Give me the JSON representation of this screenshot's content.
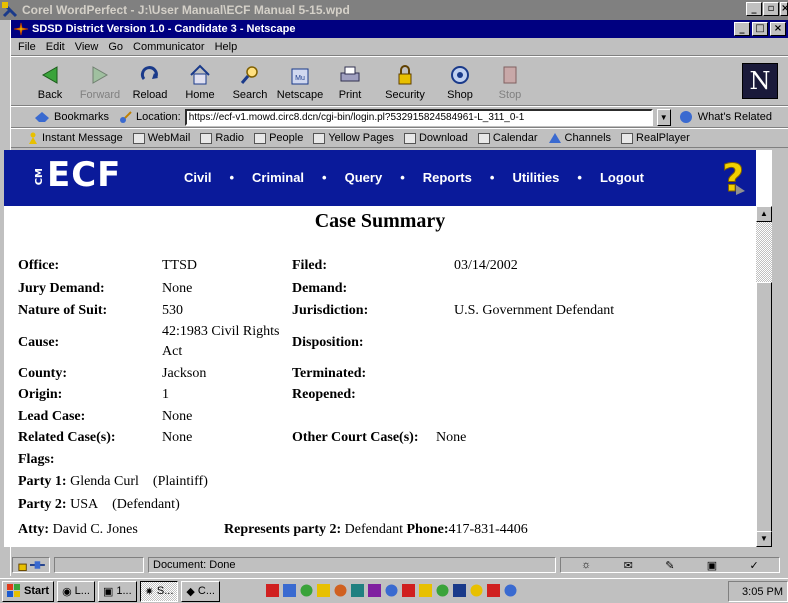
{
  "outer_window": {
    "title": "Corel WordPerfect - J:\\User Manual\\ECF Manual 5-15.wpd"
  },
  "browser": {
    "title": "SDSD District Version 1.0 - Candidate 3 - Netscape",
    "menu": [
      "File",
      "Edit",
      "View",
      "Go",
      "Communicator",
      "Help"
    ],
    "toolbar": [
      {
        "label": "Back",
        "icon": "back-arrow-icon"
      },
      {
        "label": "Forward",
        "icon": "forward-arrow-icon",
        "disabled": true
      },
      {
        "label": "Reload",
        "icon": "reload-icon"
      },
      {
        "label": "Home",
        "icon": "home-icon"
      },
      {
        "label": "Search",
        "icon": "search-icon"
      },
      {
        "label": "Netscape",
        "icon": "netscape-icon"
      },
      {
        "label": "Print",
        "icon": "print-icon"
      },
      {
        "label": "Security",
        "icon": "lock-icon"
      },
      {
        "label": "Shop",
        "icon": "shop-icon"
      },
      {
        "label": "Stop",
        "icon": "stop-icon",
        "disabled": true
      }
    ],
    "bookmarks_label": "Bookmarks",
    "location_label": "Location:",
    "location_url": "https://ecf-v1.mowd.circ8.dcn/cgi-bin/login.pl?532915824584961-L_311_0-1",
    "whats_related": "What's Related",
    "personal": [
      "Instant Message",
      "WebMail",
      "Radio",
      "People",
      "Yellow Pages",
      "Download",
      "Calendar",
      "Channels",
      "RealPlayer"
    ],
    "status_text": "Document: Done"
  },
  "cmecf": {
    "logo_small": "CM",
    "logo_big": "ECF",
    "nav": [
      "Civil",
      "Criminal",
      "Query",
      "Reports",
      "Utilities",
      "Logout"
    ],
    "separator": "•"
  },
  "page": {
    "title": "Case Summary",
    "left": [
      {
        "label": "Office:",
        "value": "TTSD"
      },
      {
        "label": "Jury Demand:",
        "value": "None"
      },
      {
        "label": "Nature of Suit:",
        "value": "530"
      },
      {
        "label": "Cause:",
        "value": "42:1983 Civil Rights",
        "value2": "Act"
      },
      {
        "label": "County:",
        "value": "Jackson"
      },
      {
        "label": "Origin:",
        "value": "1"
      },
      {
        "label": "Lead Case:",
        "value": "None"
      },
      {
        "label": "Related Case(s):",
        "value": "None"
      },
      {
        "label": "Flags:",
        "value": ""
      }
    ],
    "right": [
      {
        "label": "Filed:",
        "value": "03/14/2002"
      },
      {
        "label": "Demand:",
        "value": ""
      },
      {
        "label": "Jurisdiction:",
        "value": "U.S. Government Defendant"
      },
      {
        "label": "Disposition:",
        "value": ""
      },
      {
        "label": "Terminated:",
        "value": ""
      },
      {
        "label": "Reopened:",
        "value": ""
      },
      {
        "label": "Other Court Case(s):",
        "value": "None"
      }
    ],
    "party1": {
      "label": "Party 1:",
      "name": "Glenda Curl",
      "role": "(Plaintiff)"
    },
    "party2": {
      "label": "Party 2:",
      "name": "USA",
      "role": "(Defendant)"
    },
    "atty": {
      "label": "Atty:",
      "name": "David C. Jones",
      "rep_label": "Represents party 2:",
      "rep_value": "Defendant",
      "phone_label": "Phone:",
      "phone_value": "417-831-4406"
    }
  },
  "taskbar": {
    "start": "Start",
    "tasks": [
      "L...",
      "1...",
      "S...",
      "C..."
    ],
    "clock": "3:05 PM"
  }
}
